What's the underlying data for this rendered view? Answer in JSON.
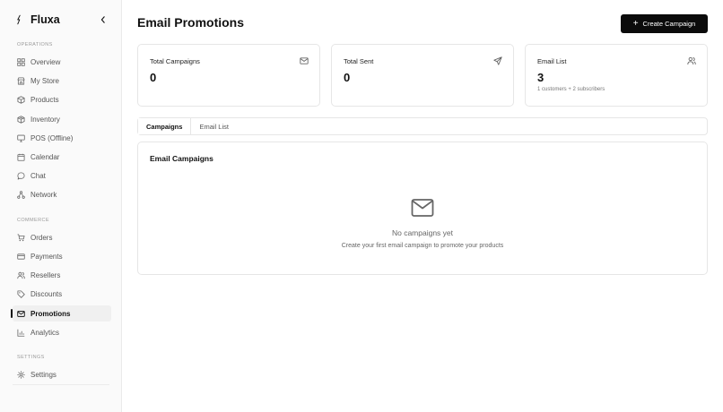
{
  "brand": {
    "name": "Fluxa"
  },
  "sidebar": {
    "sections": [
      {
        "label": "OPERATIONS"
      },
      {
        "label": "COMMERCE"
      },
      {
        "label": "SETTINGS"
      }
    ],
    "items": [
      {
        "label": "Overview",
        "icon": "grid-icon"
      },
      {
        "label": "My Store",
        "icon": "store-icon"
      },
      {
        "label": "Products",
        "icon": "box-icon"
      },
      {
        "label": "Inventory",
        "icon": "package-icon"
      },
      {
        "label": "POS (Offline)",
        "icon": "monitor-icon"
      },
      {
        "label": "Calendar",
        "icon": "calendar-icon"
      },
      {
        "label": "Chat",
        "icon": "chat-icon"
      },
      {
        "label": "Network",
        "icon": "network-icon"
      },
      {
        "label": "Orders",
        "icon": "cart-icon"
      },
      {
        "label": "Payments",
        "icon": "card-icon"
      },
      {
        "label": "Resellers",
        "icon": "users-icon"
      },
      {
        "label": "Discounts",
        "icon": "tag-icon"
      },
      {
        "label": "Promotions",
        "icon": "mail-icon",
        "active": true
      },
      {
        "label": "Analytics",
        "icon": "bar-chart-icon"
      },
      {
        "label": "Settings",
        "icon": "gear-icon"
      }
    ]
  },
  "header": {
    "title": "Email Promotions",
    "create_label": "Create Campaign"
  },
  "stats": [
    {
      "label": "Total Campaigns",
      "value": "0",
      "sub": "",
      "icon": "mail-icon"
    },
    {
      "label": "Total Sent",
      "value": "0",
      "sub": "",
      "icon": "send-icon"
    },
    {
      "label": "Email List",
      "value": "3",
      "sub": "1 customers + 2 subscribers",
      "icon": "users-icon"
    }
  ],
  "tabs": [
    {
      "label": "Campaigns",
      "active": true
    },
    {
      "label": "Email List",
      "active": false
    }
  ],
  "campaigns_panel": {
    "title": "Email Campaigns",
    "empty_title": "No campaigns yet",
    "empty_desc": "Create your first email campaign to promote your products",
    "empty_icon": "mail-icon"
  },
  "colors": {
    "primary": "#0b0b0b",
    "sidebar_bg": "#fafafa",
    "border": "#e6e6e6",
    "muted_text": "#666666"
  }
}
